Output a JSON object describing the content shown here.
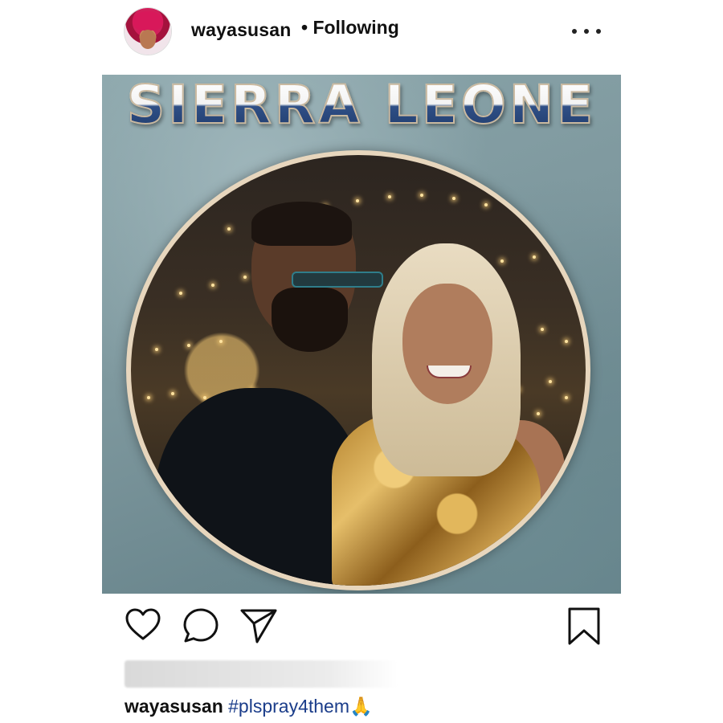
{
  "header": {
    "username": "wayasusan",
    "follow_status": "• Following",
    "more_icon": "more-horizontal-icon"
  },
  "post": {
    "banner_text": "SIERRA LEONE",
    "colors": {
      "banner_blue": "#2d4b7c",
      "ring": "#e7d6bd",
      "background": "#7e989e"
    }
  },
  "actions": {
    "like_icon": "heart-icon",
    "comment_icon": "comment-icon",
    "share_icon": "send-icon",
    "save_icon": "bookmark-icon"
  },
  "caption": {
    "username": "wayasusan",
    "hashtag": "#plspray4them",
    "emoji": "🙏"
  }
}
